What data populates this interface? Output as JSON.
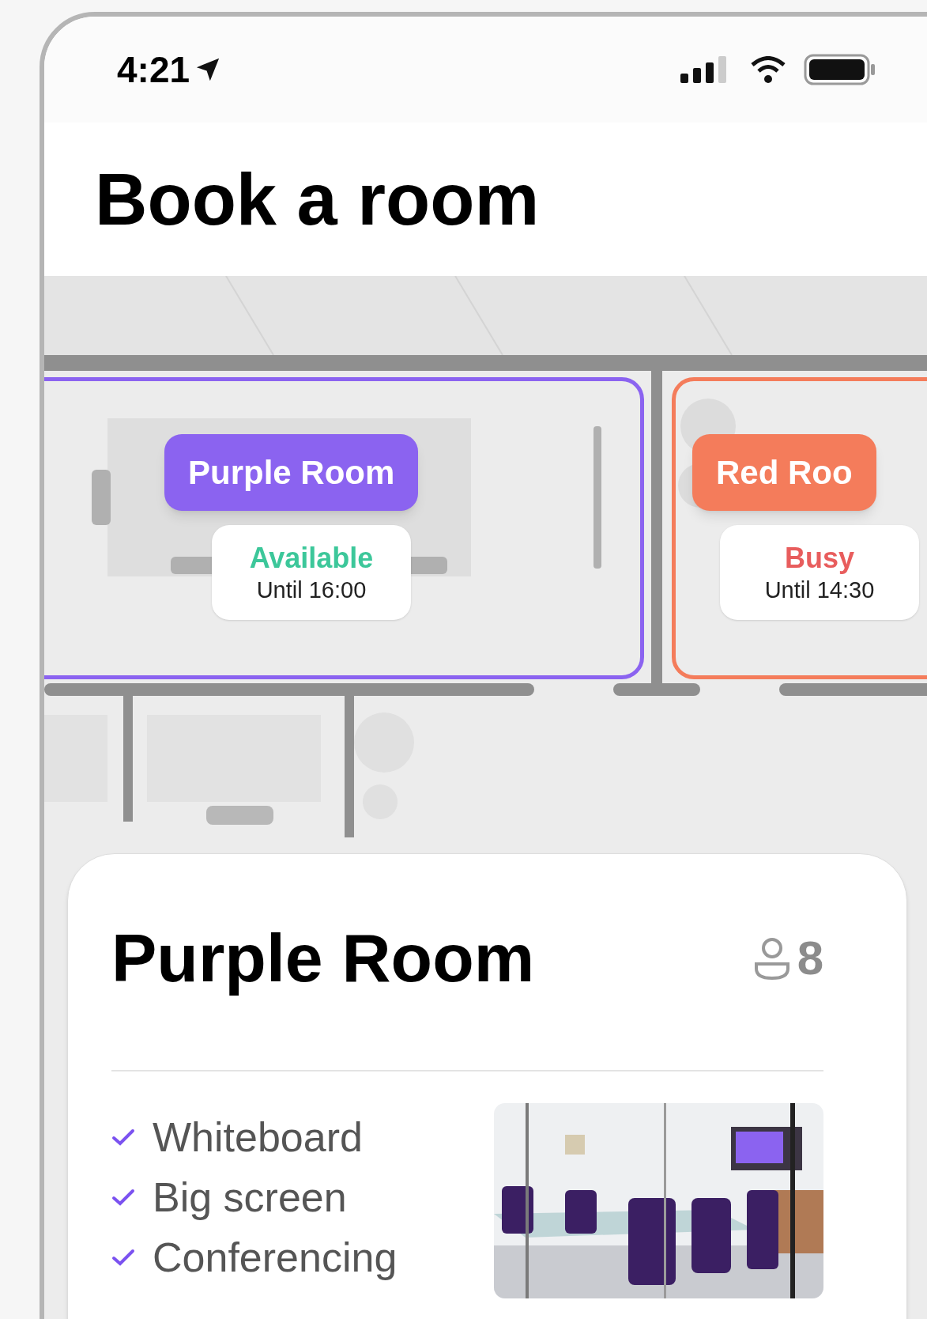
{
  "status_bar": {
    "time": "4:21"
  },
  "header": {
    "title": "Book a room"
  },
  "map": {
    "rooms": [
      {
        "name": "Purple Room",
        "color": "#8b63f0",
        "available": true,
        "status": "Available",
        "until": "Until 16:00"
      },
      {
        "name": "Red Roo",
        "color": "#f47c5b",
        "available": false,
        "status": "Busy",
        "until": "Until 14:30"
      }
    ]
  },
  "detail_card": {
    "title": "Purple Room",
    "capacity": "8",
    "amenities": [
      {
        "label": "Whiteboard",
        "checked": true
      },
      {
        "label": "Big screen",
        "checked": true
      },
      {
        "label": "Conferencing",
        "checked": true
      }
    ]
  }
}
